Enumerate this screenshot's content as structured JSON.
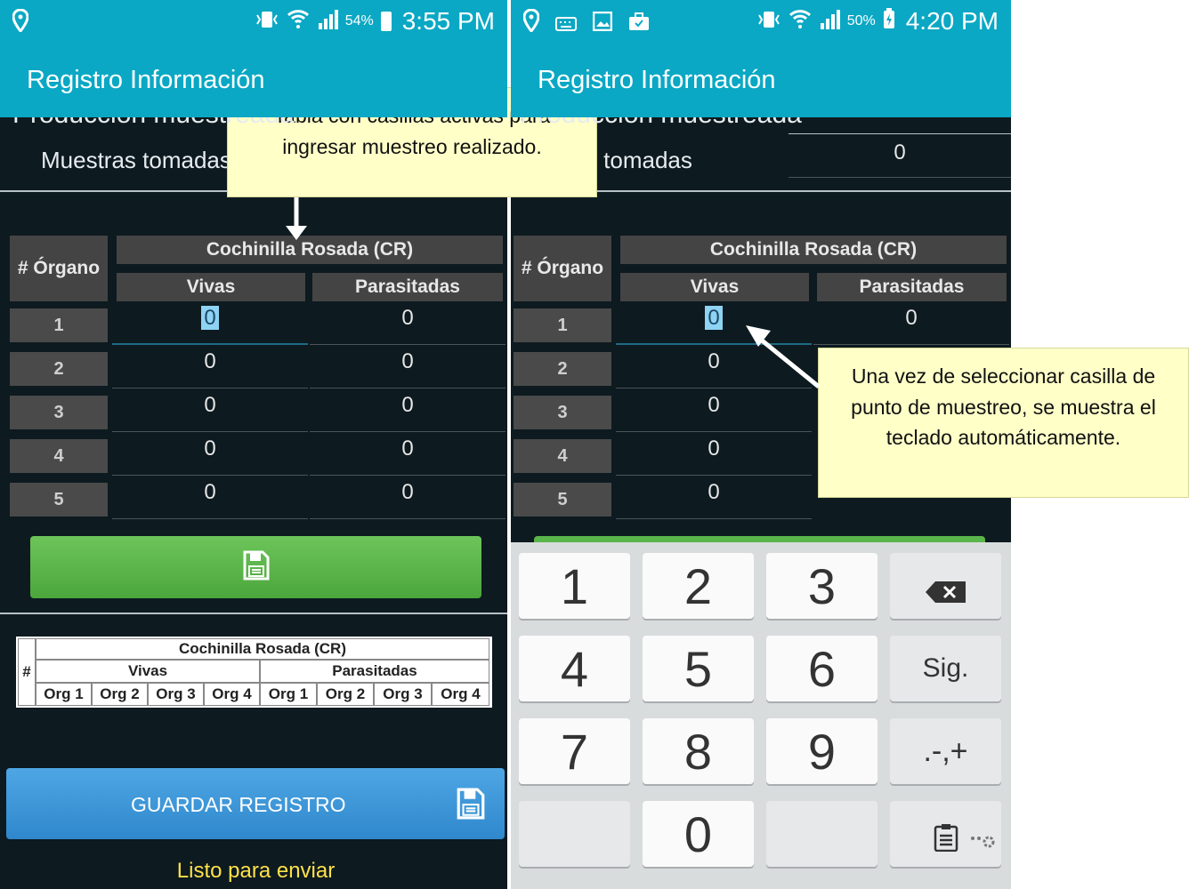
{
  "colors": {
    "accent": "#0aa8c4",
    "background": "#0d1a20",
    "save_green": "#5ab54a",
    "primary_blue": "#3a94d6",
    "ready_text": "#ffe14a",
    "callout_bg": "#ffffc8"
  },
  "left": {
    "status": {
      "battery": "54%",
      "time": "3:55 PM"
    },
    "app_title": "Registro Información",
    "partial_row": "Producción muestreada",
    "muestras_label": "Muestras tomadas",
    "table": {
      "organo_header": "# Órgano",
      "group_header": "Cochinilla Rosada (CR)",
      "col_vivas": "Vivas",
      "col_parasitadas": "Parasitadas",
      "rows": [
        {
          "n": "1",
          "vivas": "0",
          "parasitadas": "0"
        },
        {
          "n": "2",
          "vivas": "0",
          "parasitadas": "0"
        },
        {
          "n": "3",
          "vivas": "0",
          "parasitadas": "0"
        },
        {
          "n": "4",
          "vivas": "0",
          "parasitadas": "0"
        },
        {
          "n": "5",
          "vivas": "0",
          "parasitadas": "0"
        }
      ]
    },
    "summary_table": {
      "hash": "#",
      "title": "Cochinilla Rosada (CR)",
      "vivas": "Vivas",
      "parasitadas": "Parasitadas",
      "orgs": [
        "Org 1",
        "Org 2",
        "Org 3",
        "Org 4",
        "Org 1",
        "Org 2",
        "Org 3",
        "Org 4"
      ]
    },
    "save_button": "GUARDAR REGISTRO",
    "ready_text": "Listo para enviar"
  },
  "right": {
    "status": {
      "battery": "50%",
      "time": "4:20 PM"
    },
    "app_title": "Registro Información",
    "partial_row": "Producción muestreada",
    "muestras_label": "Muestras tomadas",
    "muestras_value": "0",
    "table": {
      "organo_header": "# Órgano",
      "group_header": "Cochinilla Rosada (CR)",
      "col_vivas": "Vivas",
      "col_parasitadas": "Parasitadas",
      "rows": [
        {
          "n": "1",
          "vivas": "0",
          "parasitadas": "0"
        },
        {
          "n": "2",
          "vivas": "0"
        },
        {
          "n": "3",
          "vivas": "0"
        },
        {
          "n": "4",
          "vivas": "0"
        },
        {
          "n": "5",
          "vivas": "0"
        }
      ]
    },
    "keyboard": {
      "keys": [
        "1",
        "2",
        "3",
        "4",
        "5",
        "6",
        "7",
        "8",
        "9",
        "0"
      ],
      "next": "Sig.",
      "symbols": ".-,+"
    }
  },
  "callouts": {
    "top": "Tabla con casillas activas para ingresar muestreo realizado.",
    "right": "Una vez de seleccionar casilla de punto de muestreo, se muestra el teclado automáticamente."
  },
  "icons": [
    "location-icon",
    "vibrate-icon",
    "wifi-icon",
    "signal-icon",
    "battery-icon",
    "keyboard-icon",
    "gallery-icon",
    "briefcase-icon",
    "floppy-icon",
    "backspace-icon",
    "clipboard-icon",
    "settings-icon"
  ]
}
